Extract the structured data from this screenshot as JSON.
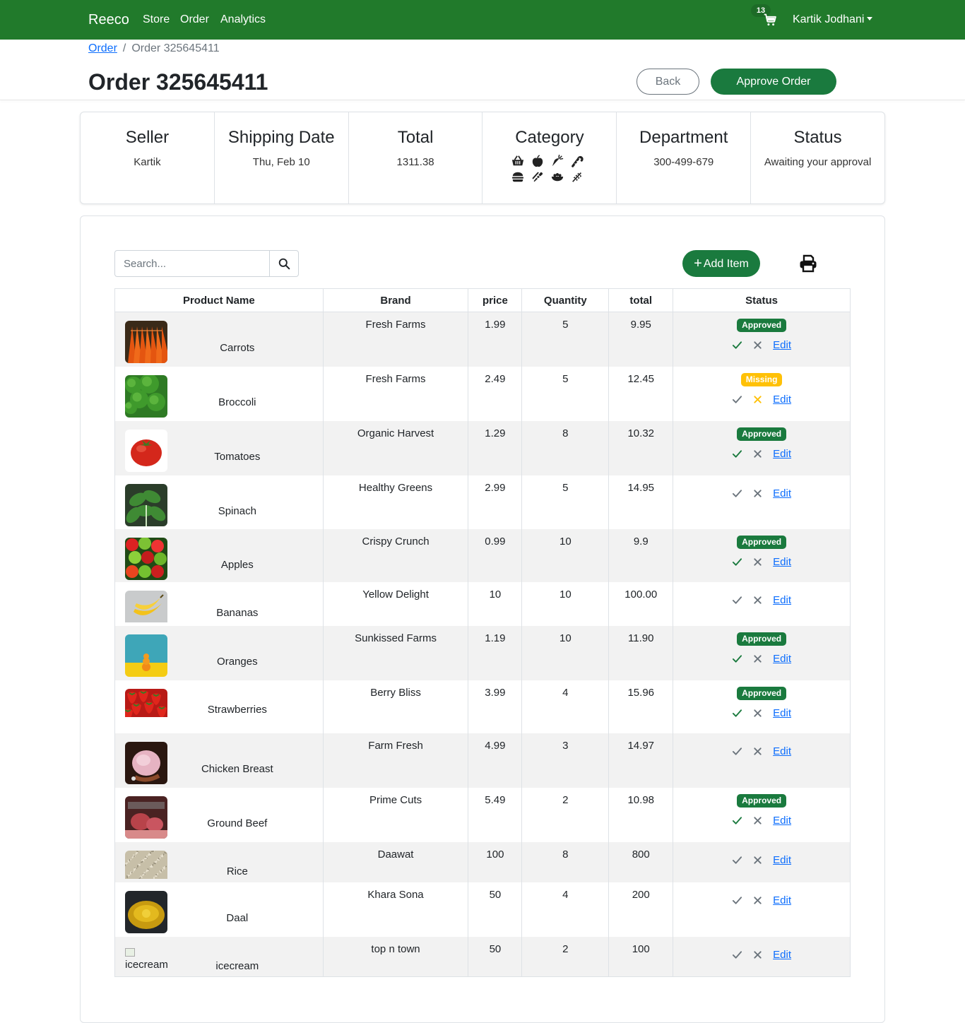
{
  "nav": {
    "brand": "Reeco",
    "links": [
      "Store",
      "Order",
      "Analytics"
    ],
    "cart_count": "13",
    "user": "Kartik Jodhani"
  },
  "breadcrumb": {
    "parent": "Order",
    "current": "Order 325645411"
  },
  "page": {
    "title": "Order 325645411",
    "back_label": "Back",
    "approve_label": "Approve Order"
  },
  "summary": {
    "seller": {
      "label": "Seller",
      "value": "Kartik"
    },
    "shipping": {
      "label": "Shipping Date",
      "value": "Thu, Feb 10"
    },
    "total": {
      "label": "Total",
      "value": "1311.38"
    },
    "category": {
      "label": "Category",
      "icons": [
        "basket-icon",
        "apple-icon",
        "carrot-icon",
        "candy-cane-icon",
        "burger-icon",
        "bread-icon",
        "bowl-icon",
        "wheat-icon"
      ]
    },
    "department": {
      "label": "Department",
      "value": "300-499-679"
    },
    "status": {
      "label": "Status",
      "value": "Awaiting your approval"
    }
  },
  "toolbar": {
    "search_placeholder": "Search...",
    "add_label": "Add Item"
  },
  "table": {
    "headers": [
      "Product Name",
      "Brand",
      "price",
      "Quantity",
      "total",
      "Status"
    ],
    "edit_label": "Edit",
    "rows": [
      {
        "name": "Carrots",
        "brand": "Fresh Farms",
        "price": "1.99",
        "qty": "5",
        "total": "9.95",
        "status": "Approved",
        "image": "carrots"
      },
      {
        "name": "Broccoli",
        "brand": "Fresh Farms",
        "price": "2.49",
        "qty": "5",
        "total": "12.45",
        "status": "Missing",
        "image": "broccoli"
      },
      {
        "name": "Tomatoes",
        "brand": "Organic Harvest",
        "price": "1.29",
        "qty": "8",
        "total": "10.32",
        "status": "Approved",
        "image": "tomato"
      },
      {
        "name": "Spinach",
        "brand": "Healthy Greens",
        "price": "2.99",
        "qty": "5",
        "total": "14.95",
        "status": "",
        "image": "spinach"
      },
      {
        "name": "Apples",
        "brand": "Crispy Crunch",
        "price": "0.99",
        "qty": "10",
        "total": "9.9",
        "status": "Approved",
        "image": "apples"
      },
      {
        "name": "Bananas",
        "brand": "Yellow Delight",
        "price": "10",
        "qty": "10",
        "total": "100.00",
        "status": "",
        "image": "bananas"
      },
      {
        "name": "Oranges",
        "brand": "Sunkissed Farms",
        "price": "1.19",
        "qty": "10",
        "total": "11.90",
        "status": "Approved",
        "image": "oranges"
      },
      {
        "name": "Strawberries",
        "brand": "Berry Bliss",
        "price": "3.99",
        "qty": "4",
        "total": "15.96",
        "status": "Approved",
        "image": "strawberries"
      },
      {
        "name": "Chicken Breast",
        "brand": "Farm Fresh",
        "price": "4.99",
        "qty": "3",
        "total": "14.97",
        "status": "",
        "image": "chicken"
      },
      {
        "name": "Ground Beef",
        "brand": "Prime Cuts",
        "price": "5.49",
        "qty": "2",
        "total": "10.98",
        "status": "Approved",
        "image": "beef"
      },
      {
        "name": "Rice",
        "brand": "Daawat",
        "price": "100",
        "qty": "8",
        "total": "800",
        "status": "",
        "image": "rice"
      },
      {
        "name": "Daal",
        "brand": "Khara Sona",
        "price": "50",
        "qty": "4",
        "total": "200",
        "status": "",
        "image": "daal"
      },
      {
        "name": "icecream",
        "brand": "top n town",
        "price": "50",
        "qty": "2",
        "total": "100",
        "status": "",
        "image": "broken",
        "alt": "icecream"
      }
    ]
  },
  "colors": {
    "navbar": "#217a2b",
    "primary": "#1a7a3e",
    "approved": "#1a7a3e",
    "missing": "#ffc107",
    "link": "#0d6efd"
  }
}
